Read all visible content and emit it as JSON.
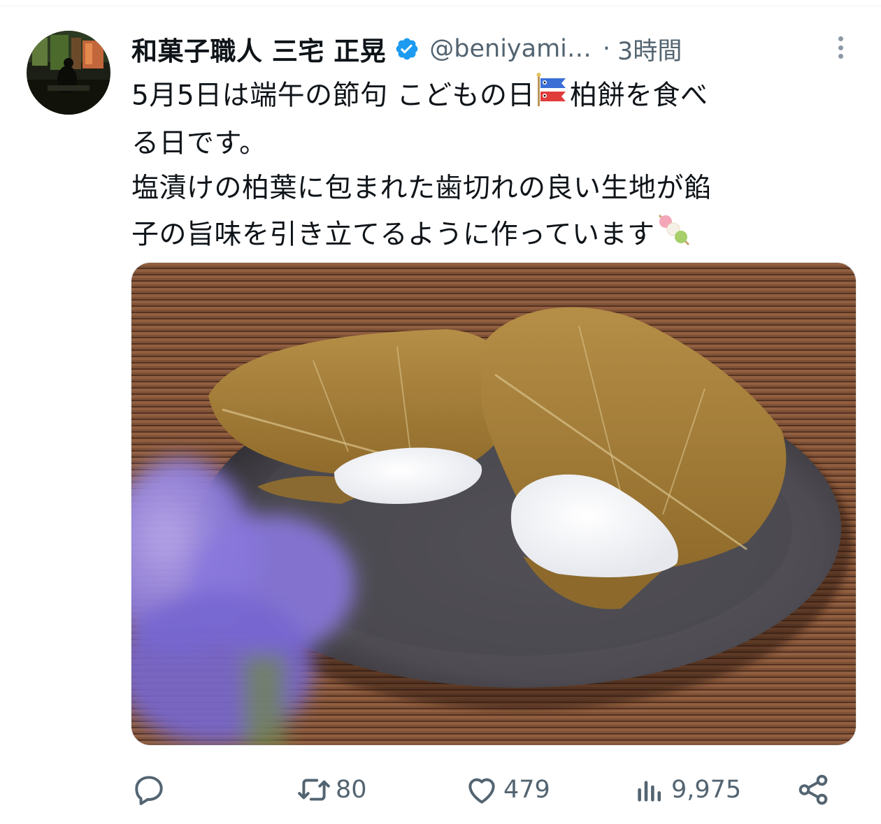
{
  "tweet": {
    "author": {
      "display_name": "和菓子職人 三宅 正晃",
      "handle": "@beniyami…",
      "verified": true
    },
    "separator": "·",
    "time": "3時間",
    "text_lines": [
      {
        "before": "5月5日は端午の節句 こどもの日",
        "emoji": "koinobori",
        "after": "柏餅を食べ"
      },
      {
        "text": "る日です。"
      },
      {
        "text": "塩漬けの柏葉に包まれた歯切れの良い生地が餡"
      },
      {
        "before": "子の旨味を引き立てるように作っています",
        "emoji": "dango",
        "after": ""
      }
    ],
    "metrics": {
      "replies": "",
      "retweets": "80",
      "likes": "479",
      "views": "9,975"
    }
  },
  "icons": {
    "verified": "verified-badge-icon",
    "more": "more-vertical-icon",
    "reply": "reply-icon",
    "retweet": "retweet-icon",
    "like": "heart-icon",
    "views": "analytics-icon",
    "share": "share-icon"
  },
  "colors": {
    "text": "#0f1419",
    "secondary": "#536471",
    "verified": "#1d9bf0"
  }
}
